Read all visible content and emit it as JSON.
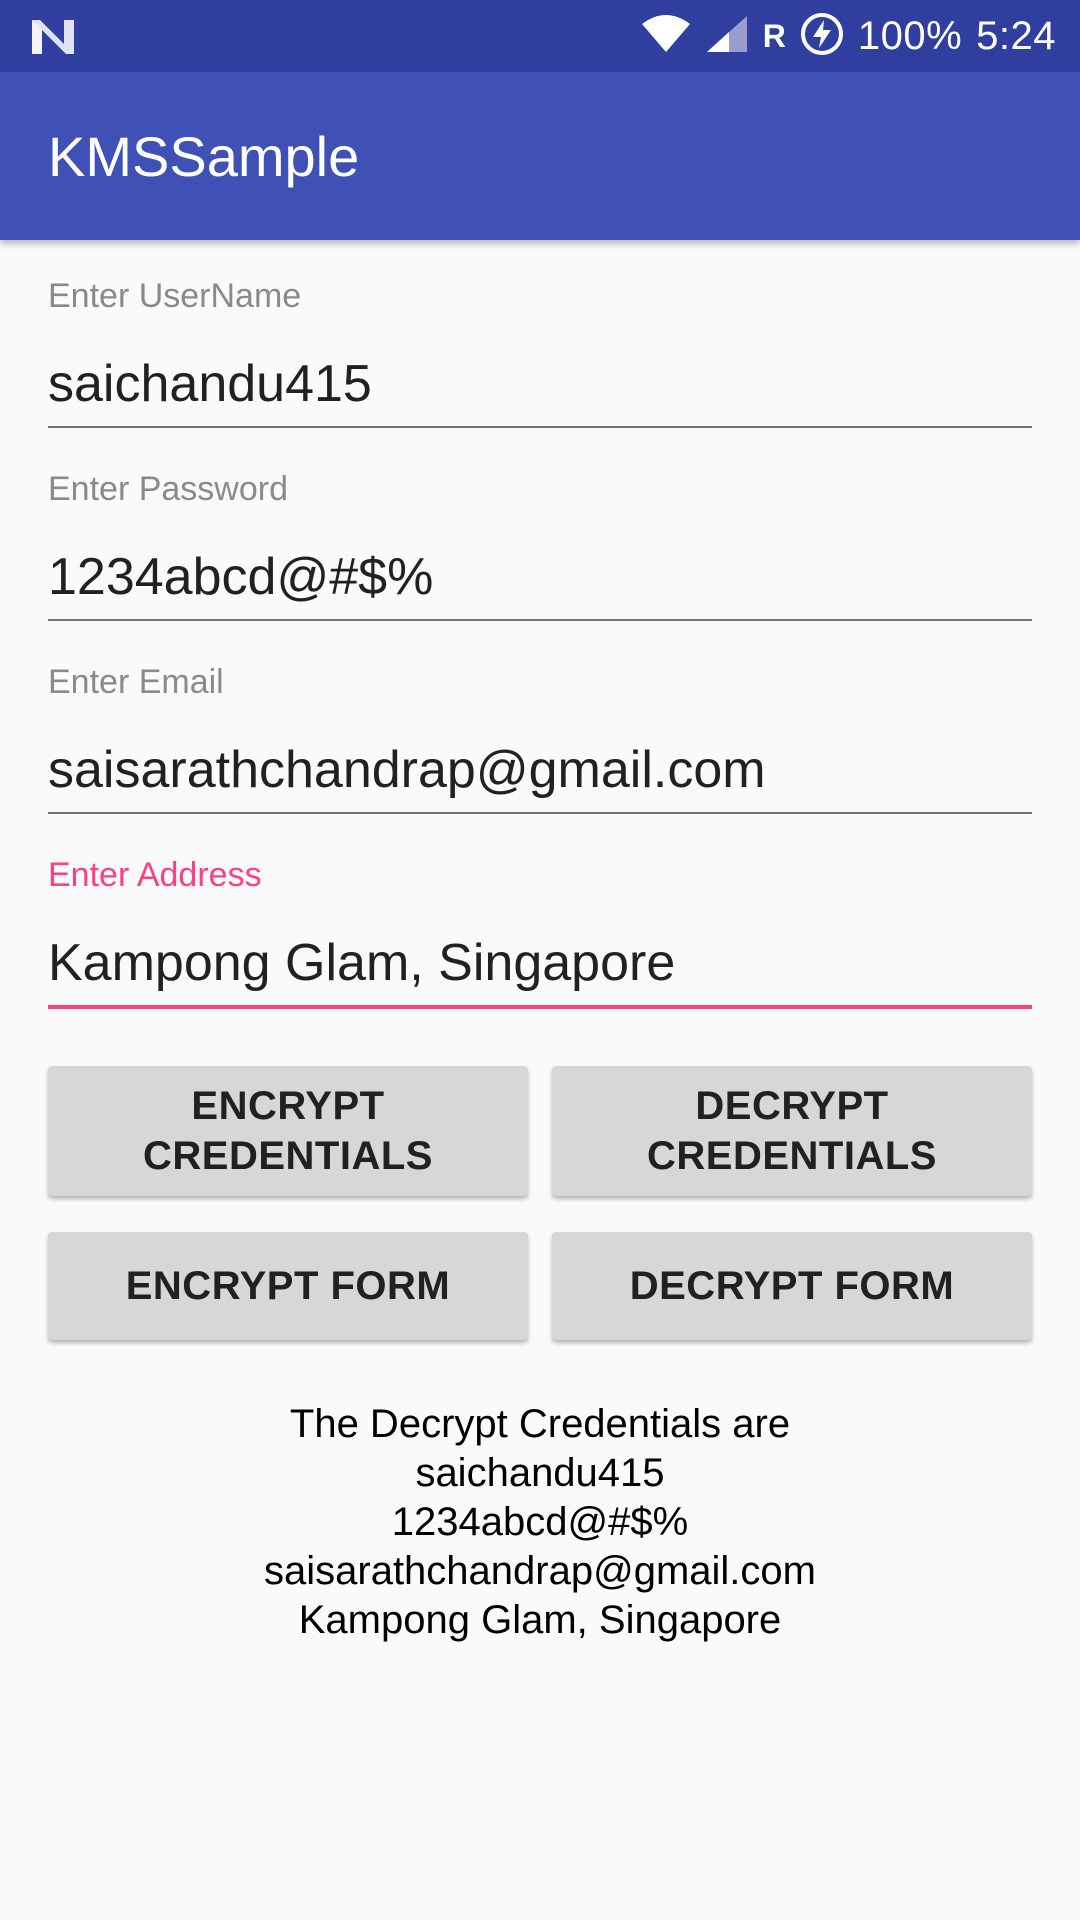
{
  "status_bar": {
    "battery_text": "100%",
    "time": "5:24",
    "roaming_label": "R",
    "icons": [
      "notification-n-icon",
      "wifi-icon",
      "signal-icon",
      "battery-charging-icon"
    ]
  },
  "app_bar": {
    "title": "KMSSample"
  },
  "form": {
    "username": {
      "label": "Enter UserName",
      "value": "saichandu415"
    },
    "password": {
      "label": "Enter Password",
      "value": "1234abcd@#$%"
    },
    "email": {
      "label": "Enter Email",
      "value": "saisarathchandrap@gmail.com"
    },
    "address": {
      "label": "Enter Address",
      "value": "Kampong Glam, Singapore",
      "focused": true
    }
  },
  "buttons": {
    "encrypt_credentials": {
      "line1": "ENCRYPT",
      "line2": "CREDENTIALS"
    },
    "decrypt_credentials": {
      "line1": "DECRYPT",
      "line2": "CREDENTIALS"
    },
    "encrypt_form": "ENCRYPT FORM",
    "decrypt_form": "DECRYPT FORM"
  },
  "result": {
    "lines": [
      "The Decrypt Credentials are",
      "saichandu415",
      "1234abcd@#$%",
      "saisarathchandrap@gmail.com",
      "Kampong Glam, Singapore"
    ]
  },
  "colors": {
    "status_bar": "#303f9f",
    "app_bar": "#3f51b5",
    "accent": "#ff4081",
    "button": "#d6d7d7",
    "background": "#fafafa"
  }
}
